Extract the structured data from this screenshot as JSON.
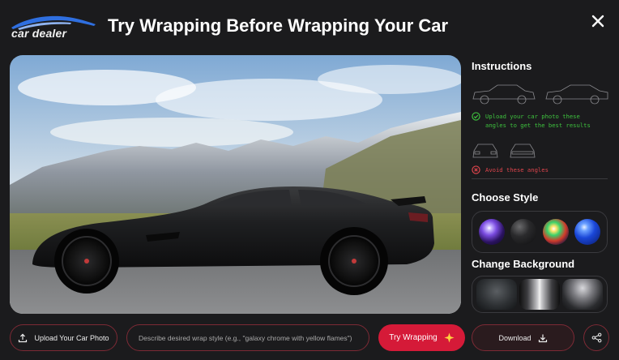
{
  "header": {
    "logo_text": "car dealer",
    "title": "Try Wrapping Before Wrapping Your Car"
  },
  "instructions": {
    "heading": "Instructions",
    "good_line1": "Upload your car photo these",
    "good_line2": "angles to get the best results",
    "bad_text": "Avoid these angles"
  },
  "style": {
    "heading": "Choose Style",
    "swatches": [
      "purple-chrome",
      "matte-black",
      "rainbow-chrome",
      "blue-chrome"
    ]
  },
  "background": {
    "heading": "Change Background",
    "thumbs": [
      "rocky-terrain",
      "tunnel",
      "garage"
    ]
  },
  "toolbar": {
    "upload_label": "Upload Your Car Photo",
    "prompt_placeholder": "Describe desired wrap style (e.g., \"galaxy chrome with yellow flames\")",
    "prompt_value": "",
    "try_label": "Try Wrapping",
    "download_label": "Download"
  },
  "colors": {
    "accent": "#d51a38",
    "ok": "#3ec23e",
    "bad": "#e0454d",
    "background": "#1b1b1d"
  }
}
